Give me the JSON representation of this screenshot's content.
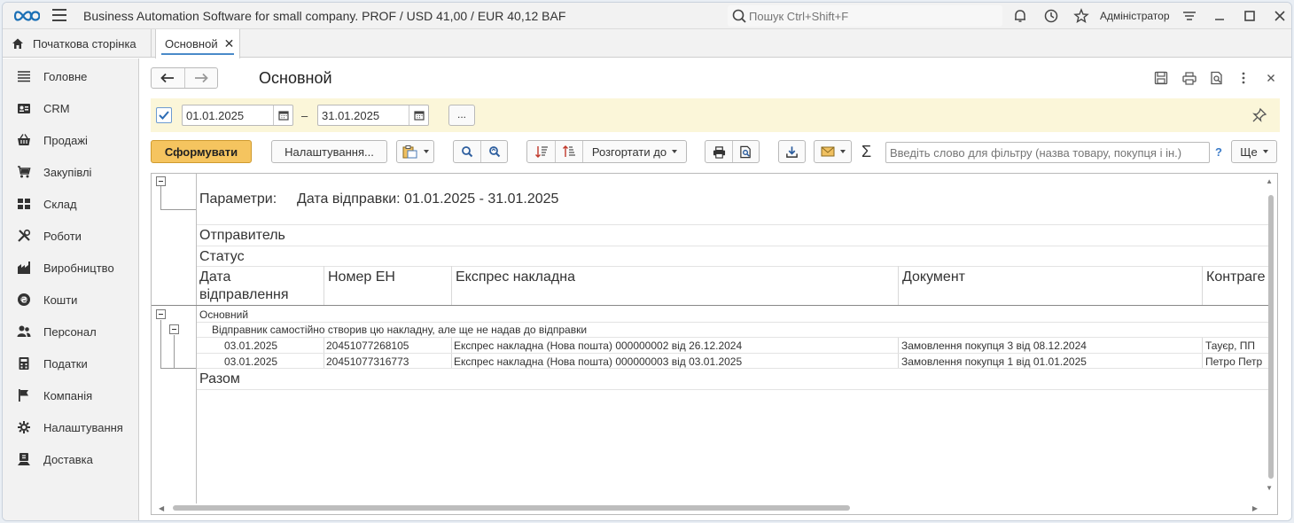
{
  "topbar": {
    "app_title": "Business Automation Software for small company. PROF / USD 41,00 / EUR 40,12 BAF",
    "search_placeholder": "Пошук Ctrl+Shift+F",
    "user": "Адміністратор"
  },
  "tabs": {
    "home": "Початкова сторінка",
    "active": "Основной"
  },
  "sidebar": {
    "items": [
      {
        "label": "Головне",
        "icon": "menu-lines-icon"
      },
      {
        "label": "CRM",
        "icon": "contact-card-icon"
      },
      {
        "label": "Продажі",
        "icon": "basket-icon"
      },
      {
        "label": "Закупівлі",
        "icon": "cart-icon"
      },
      {
        "label": "Склад",
        "icon": "warehouse-grid-icon"
      },
      {
        "label": "Роботи",
        "icon": "tools-icon"
      },
      {
        "label": "Виробництво",
        "icon": "factory-icon"
      },
      {
        "label": "Кошти",
        "icon": "money-icon"
      },
      {
        "label": "Персонал",
        "icon": "people-icon"
      },
      {
        "label": "Податки",
        "icon": "calculator-icon"
      },
      {
        "label": "Компанія",
        "icon": "flag-icon"
      },
      {
        "label": "Налаштування",
        "icon": "gear-icon"
      },
      {
        "label": "Доставка",
        "icon": "delivery-icon"
      }
    ]
  },
  "form": {
    "title": "Основной",
    "period": {
      "from": "01.01.2025",
      "dash": "–",
      "to": "31.01.2025",
      "more": "..."
    },
    "toolbar": {
      "generate": "Сформувати",
      "settings": "Налаштування...",
      "expand_to": "Розгортати до",
      "sigma": "Σ",
      "filter_placeholder": "Введіть слово для фільтру (назва товару, покупця і ін.)",
      "help": "?",
      "more": "Ще"
    }
  },
  "report": {
    "params_label": "Параметри:",
    "params_value": "Дата відправки: 01.01.2025 - 31.01.2025",
    "group1": "Отправитель",
    "group2": "Статус",
    "columns": [
      "Дата відправлення",
      "Номер ЕН",
      "Експрес накладна",
      "Документ",
      "Контраге"
    ],
    "col0_line1": "Дата",
    "col0_line2": "відправлення",
    "sender": "Основний",
    "status": "Відправник самостійно створив цю накладну, але ще не надав до відправки",
    "rows": [
      {
        "date": "03.01.2025",
        "number": "20451077268105",
        "waybill": "Експрес накладна (Нова пошта) 000000002 від 26.12.2024",
        "document": "Замовлення покупця 3 від 08.12.2024",
        "counterparty": "Тауєр, ПП"
      },
      {
        "date": "03.01.2025",
        "number": "20451077316773",
        "waybill": "Експрес накладна (Нова пошта) 000000003 від 03.01.2025",
        "document": "Замовлення покупця 1 від 01.01.2025",
        "counterparty": "Петро Петр"
      }
    ],
    "total": "Разом"
  }
}
